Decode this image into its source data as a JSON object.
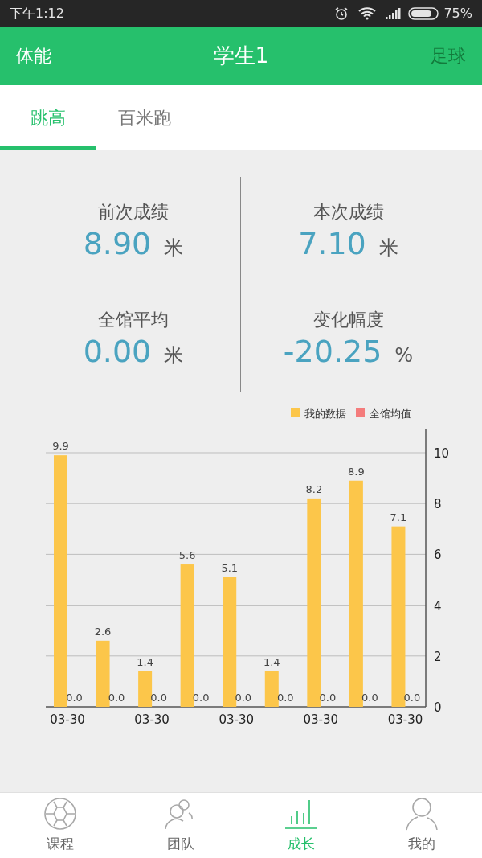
{
  "status_bar": {
    "time": "下午1:12",
    "battery": "75%"
  },
  "header": {
    "left": "体能",
    "title": "学生1",
    "right": "足球"
  },
  "tabs": [
    {
      "label": "跳高",
      "selected": true
    },
    {
      "label": "百米跑",
      "selected": false
    }
  ],
  "stats": [
    {
      "label": "前次成绩",
      "value": "8.90",
      "unit": "米"
    },
    {
      "label": "本次成绩",
      "value": "7.10",
      "unit": "米"
    },
    {
      "label": "全馆平均",
      "value": "0.00",
      "unit": "米"
    },
    {
      "label": "变化幅度",
      "value": "-20.25",
      "unit": "%"
    }
  ],
  "chart_data": {
    "type": "bar",
    "categories": [
      "03-30",
      null,
      "03-30",
      null,
      "03-30",
      null,
      "03-30",
      null,
      "03-30"
    ],
    "series": [
      {
        "name": "我的数据",
        "color": "#fcc64a",
        "values": [
          9.9,
          2.6,
          1.4,
          5.6,
          5.1,
          1.4,
          8.2,
          8.9,
          7.1
        ],
        "value_labels": [
          "9.9",
          "2.6",
          "1.4",
          "5.6",
          "5.1",
          "1.4",
          "8.2",
          "8.9",
          "7.1"
        ]
      },
      {
        "name": "全馆均值",
        "color": "#f47c7c",
        "values": [
          0.0,
          0.0,
          0.0,
          0.0,
          0.0,
          0.0,
          0.0,
          0.0,
          0.0
        ],
        "value_labels": [
          "0.0",
          "0.0",
          "0.0",
          "0.0",
          "0.0",
          "0.0",
          "0.0",
          "0.0",
          "0.0"
        ]
      }
    ],
    "ylim": [
      0,
      10
    ],
    "yticks": [
      0,
      2,
      4,
      6,
      8,
      10
    ],
    "grid": true
  },
  "nav": [
    {
      "label": "课程",
      "kind": "ball",
      "selected": false
    },
    {
      "label": "团队",
      "kind": "team",
      "selected": false
    },
    {
      "label": "成长",
      "kind": "growth",
      "selected": true
    },
    {
      "label": "我的",
      "kind": "person",
      "selected": false
    }
  ]
}
